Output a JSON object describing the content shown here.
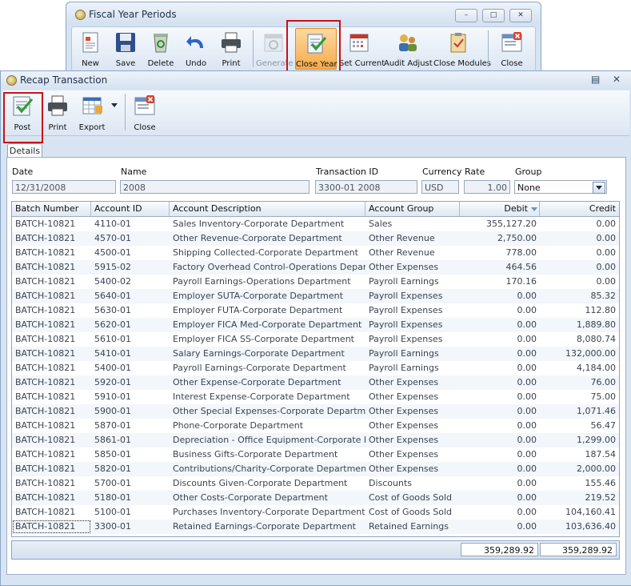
{
  "fiscal_window": {
    "title": "Fiscal Year Periods",
    "controls": [
      "–",
      "□",
      "✕"
    ],
    "toolbar": [
      {
        "label": "New",
        "icon": "new-doc-icon"
      },
      {
        "label": "Save",
        "icon": "floppy-icon"
      },
      {
        "label": "Delete",
        "icon": "recycle-bin-icon"
      },
      {
        "label": "Undo",
        "icon": "undo-arrow-icon"
      },
      {
        "label": "Print",
        "icon": "printer-icon"
      },
      {
        "label": "Generate",
        "icon": "calendar-gear-icon",
        "disabled": true
      },
      {
        "label": "Close Year",
        "icon": "checklist-icon",
        "highlighted": true
      },
      {
        "label": "Set Current",
        "icon": "calendar-icon"
      },
      {
        "label": "Audit Adjust",
        "icon": "audit-people-icon"
      },
      {
        "label": "Close Modules",
        "icon": "clipboard-check-icon"
      },
      {
        "label": "Close",
        "icon": "close-window-icon"
      }
    ]
  },
  "recap_window": {
    "title": "Recap Transaction",
    "controls": [
      "▤",
      "✕"
    ],
    "toolbar": [
      {
        "label": "Post",
        "icon": "post-checklist-icon",
        "highlighted": true
      },
      {
        "label": "Print",
        "icon": "printer-icon"
      },
      {
        "label": "Export",
        "icon": "export-grid-icon"
      },
      {
        "label": "Close",
        "icon": "close-window-icon"
      }
    ],
    "tab": "Details",
    "fields": {
      "date_label": "Date",
      "date_value": "12/31/2008",
      "name_label": "Name",
      "name_value": "2008",
      "txn_label": "Transaction ID",
      "txn_value": "3300-01 2008",
      "currency_label": "Currency",
      "currency_value": "USD",
      "rate_label": "Rate",
      "rate_value": "1.00",
      "group_label": "Group",
      "group_value": "None"
    },
    "columns": [
      "Batch Number",
      "Account ID",
      "Account Description",
      "Account Group",
      "Debit",
      "Credit"
    ],
    "rows": [
      [
        "BATCH-10821",
        "4110-01",
        "Sales Inventory-Corporate Department",
        "Sales",
        "355,127.20",
        "0.00"
      ],
      [
        "BATCH-10821",
        "4570-01",
        "Other Revenue-Corporate Department",
        "Other Revenue",
        "2,750.00",
        "0.00"
      ],
      [
        "BATCH-10821",
        "4500-01",
        "Shipping Collected-Corporate Department",
        "Other Revenue",
        "778.00",
        "0.00"
      ],
      [
        "BATCH-10821",
        "5915-02",
        "Factory Overhead Control-Operations Department",
        "Other Expenses",
        "464.56",
        "0.00"
      ],
      [
        "BATCH-10821",
        "5400-02",
        "Payroll Earnings-Operations Department",
        "Payroll Earnings",
        "170.16",
        "0.00"
      ],
      [
        "BATCH-10821",
        "5640-01",
        "Employer SUTA-Corporate Department",
        "Payroll Expenses",
        "0.00",
        "85.32"
      ],
      [
        "BATCH-10821",
        "5630-01",
        "Employer FUTA-Corporate Department",
        "Payroll Expenses",
        "0.00",
        "112.80"
      ],
      [
        "BATCH-10821",
        "5620-01",
        "Employer FICA Med-Corporate Department",
        "Payroll Expenses",
        "0.00",
        "1,889.80"
      ],
      [
        "BATCH-10821",
        "5610-01",
        "Employer FICA SS-Corporate Department",
        "Payroll Expenses",
        "0.00",
        "8,080.74"
      ],
      [
        "BATCH-10821",
        "5410-01",
        "Salary Earnings-Corporate Department",
        "Payroll Earnings",
        "0.00",
        "132,000.00"
      ],
      [
        "BATCH-10821",
        "5400-01",
        "Payroll Earnings-Corporate Department",
        "Payroll Earnings",
        "0.00",
        "4,184.00"
      ],
      [
        "BATCH-10821",
        "5920-01",
        "Other Expense-Corporate Department",
        "Other Expenses",
        "0.00",
        "76.00"
      ],
      [
        "BATCH-10821",
        "5910-01",
        "Interest Expense-Corporate Department",
        "Other Expenses",
        "0.00",
        "75.00"
      ],
      [
        "BATCH-10821",
        "5900-01",
        "Other Special Expenses-Corporate Department",
        "Other Expenses",
        "0.00",
        "1,071.46"
      ],
      [
        "BATCH-10821",
        "5870-01",
        "Phone-Corporate Department",
        "Other Expenses",
        "0.00",
        "56.47"
      ],
      [
        "BATCH-10821",
        "5861-01",
        "Depreciation - Office Equipment-Corporate Department",
        "Other Expenses",
        "0.00",
        "1,299.00"
      ],
      [
        "BATCH-10821",
        "5850-01",
        "Business Gifts-Corporate Department",
        "Other Expenses",
        "0.00",
        "187.54"
      ],
      [
        "BATCH-10821",
        "5820-01",
        "Contributions/Charity-Corporate Department",
        "Other Expenses",
        "0.00",
        "2,000.00"
      ],
      [
        "BATCH-10821",
        "5700-01",
        "Discounts Given-Corporate Department",
        "Discounts",
        "0.00",
        "155.46"
      ],
      [
        "BATCH-10821",
        "5180-01",
        "Other Costs-Corporate Department",
        "Cost of Goods Sold",
        "0.00",
        "219.52"
      ],
      [
        "BATCH-10821",
        "5100-01",
        "Purchases Inventory-Corporate Department",
        "Cost of Goods Sold",
        "0.00",
        "104,160.41"
      ],
      [
        "BATCH-10821",
        "3300-01",
        "Retained Earnings-Corporate Department",
        "Retained Earnings",
        "0.00",
        "103,636.40"
      ]
    ],
    "totals": {
      "debit": "359,289.92",
      "credit": "359,289.92"
    }
  }
}
